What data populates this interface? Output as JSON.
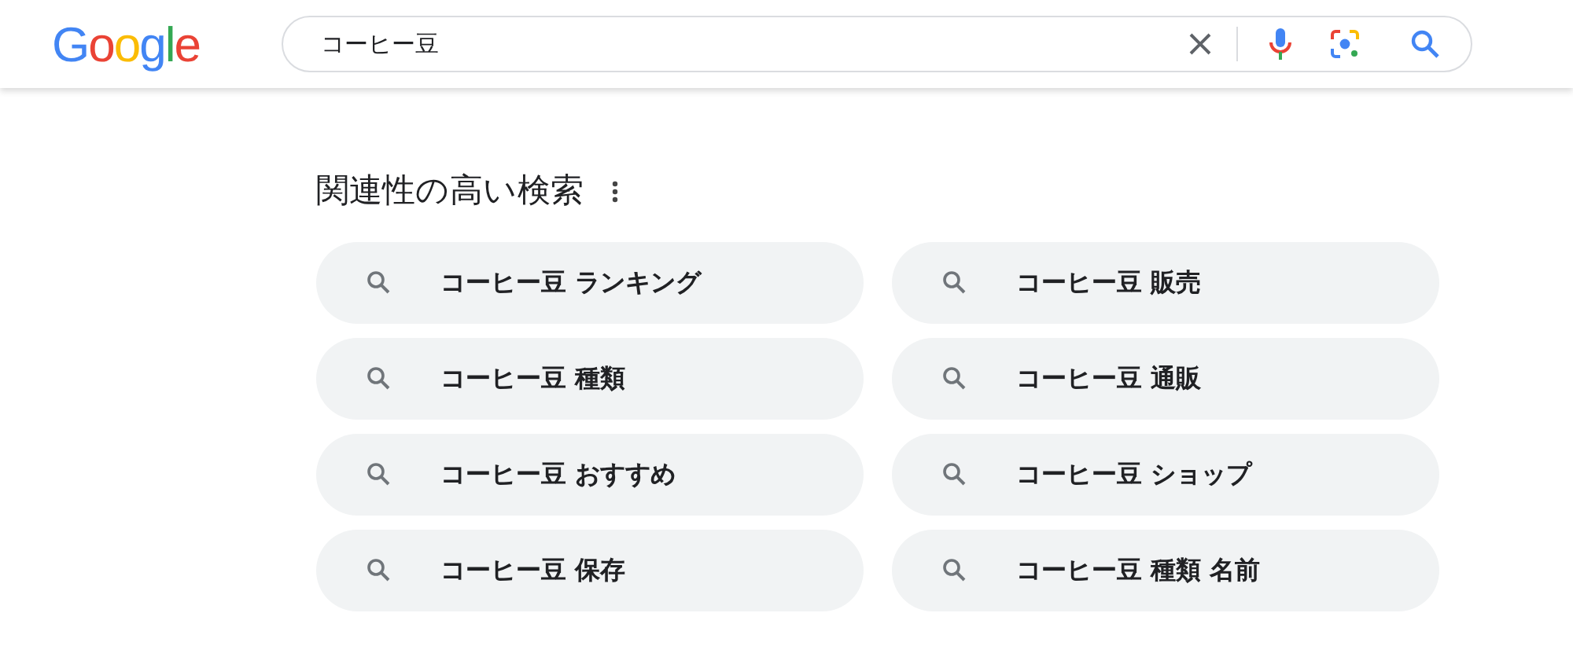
{
  "header": {
    "logo": "Google",
    "search": {
      "value": "コーヒー豆"
    }
  },
  "related": {
    "title": "関連性の高い検索",
    "items": [
      "コーヒー豆 ランキング",
      "コーヒー豆 販売",
      "コーヒー豆 種類",
      "コーヒー豆 通販",
      "コーヒー豆 おすすめ",
      "コーヒー豆 ショップ",
      "コーヒー豆 保存",
      "コーヒー豆 種類 名前"
    ]
  }
}
